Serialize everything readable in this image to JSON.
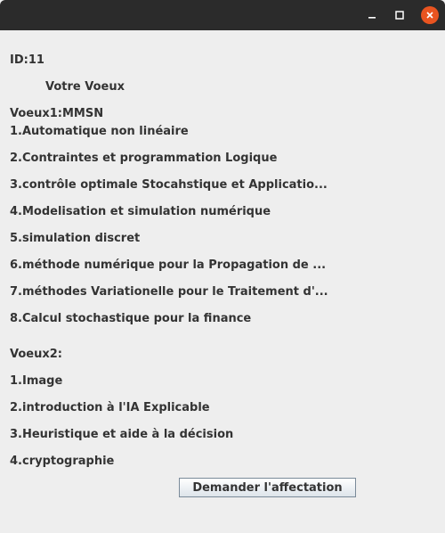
{
  "window": {
    "controls": [
      "minimize-icon",
      "maximize-icon",
      "close-icon"
    ]
  },
  "header": {
    "id_label": "ID:11",
    "title": "Votre Voeux"
  },
  "voeux1": {
    "heading": "Voeux1:MMSN",
    "items": [
      "1.Automatique non linéaire",
      "2.Contraintes et programmation Logique",
      "3.contrôle optimale Stocahstique et Applicatio...",
      "4.Modelisation et simulation numérique",
      "5.simulation discret",
      "6.méthode numérique pour la Propagation de ...",
      "7.méthodes Variationelle pour le Traitement d'...",
      "8.Calcul stochastique pour la finance"
    ]
  },
  "voeux2": {
    "heading": "Voeux2:",
    "items": [
      "1.Image",
      "2.introduction à l'IA Explicable",
      "3.Heuristique et aide à la décision",
      "4.cryptographie"
    ]
  },
  "actions": {
    "submit_label": "Demander l'affectation"
  },
  "colors": {
    "titlebar": "#2b2b2b",
    "close_button": "#e95420",
    "background": "#eeeeee",
    "text": "#333333"
  }
}
